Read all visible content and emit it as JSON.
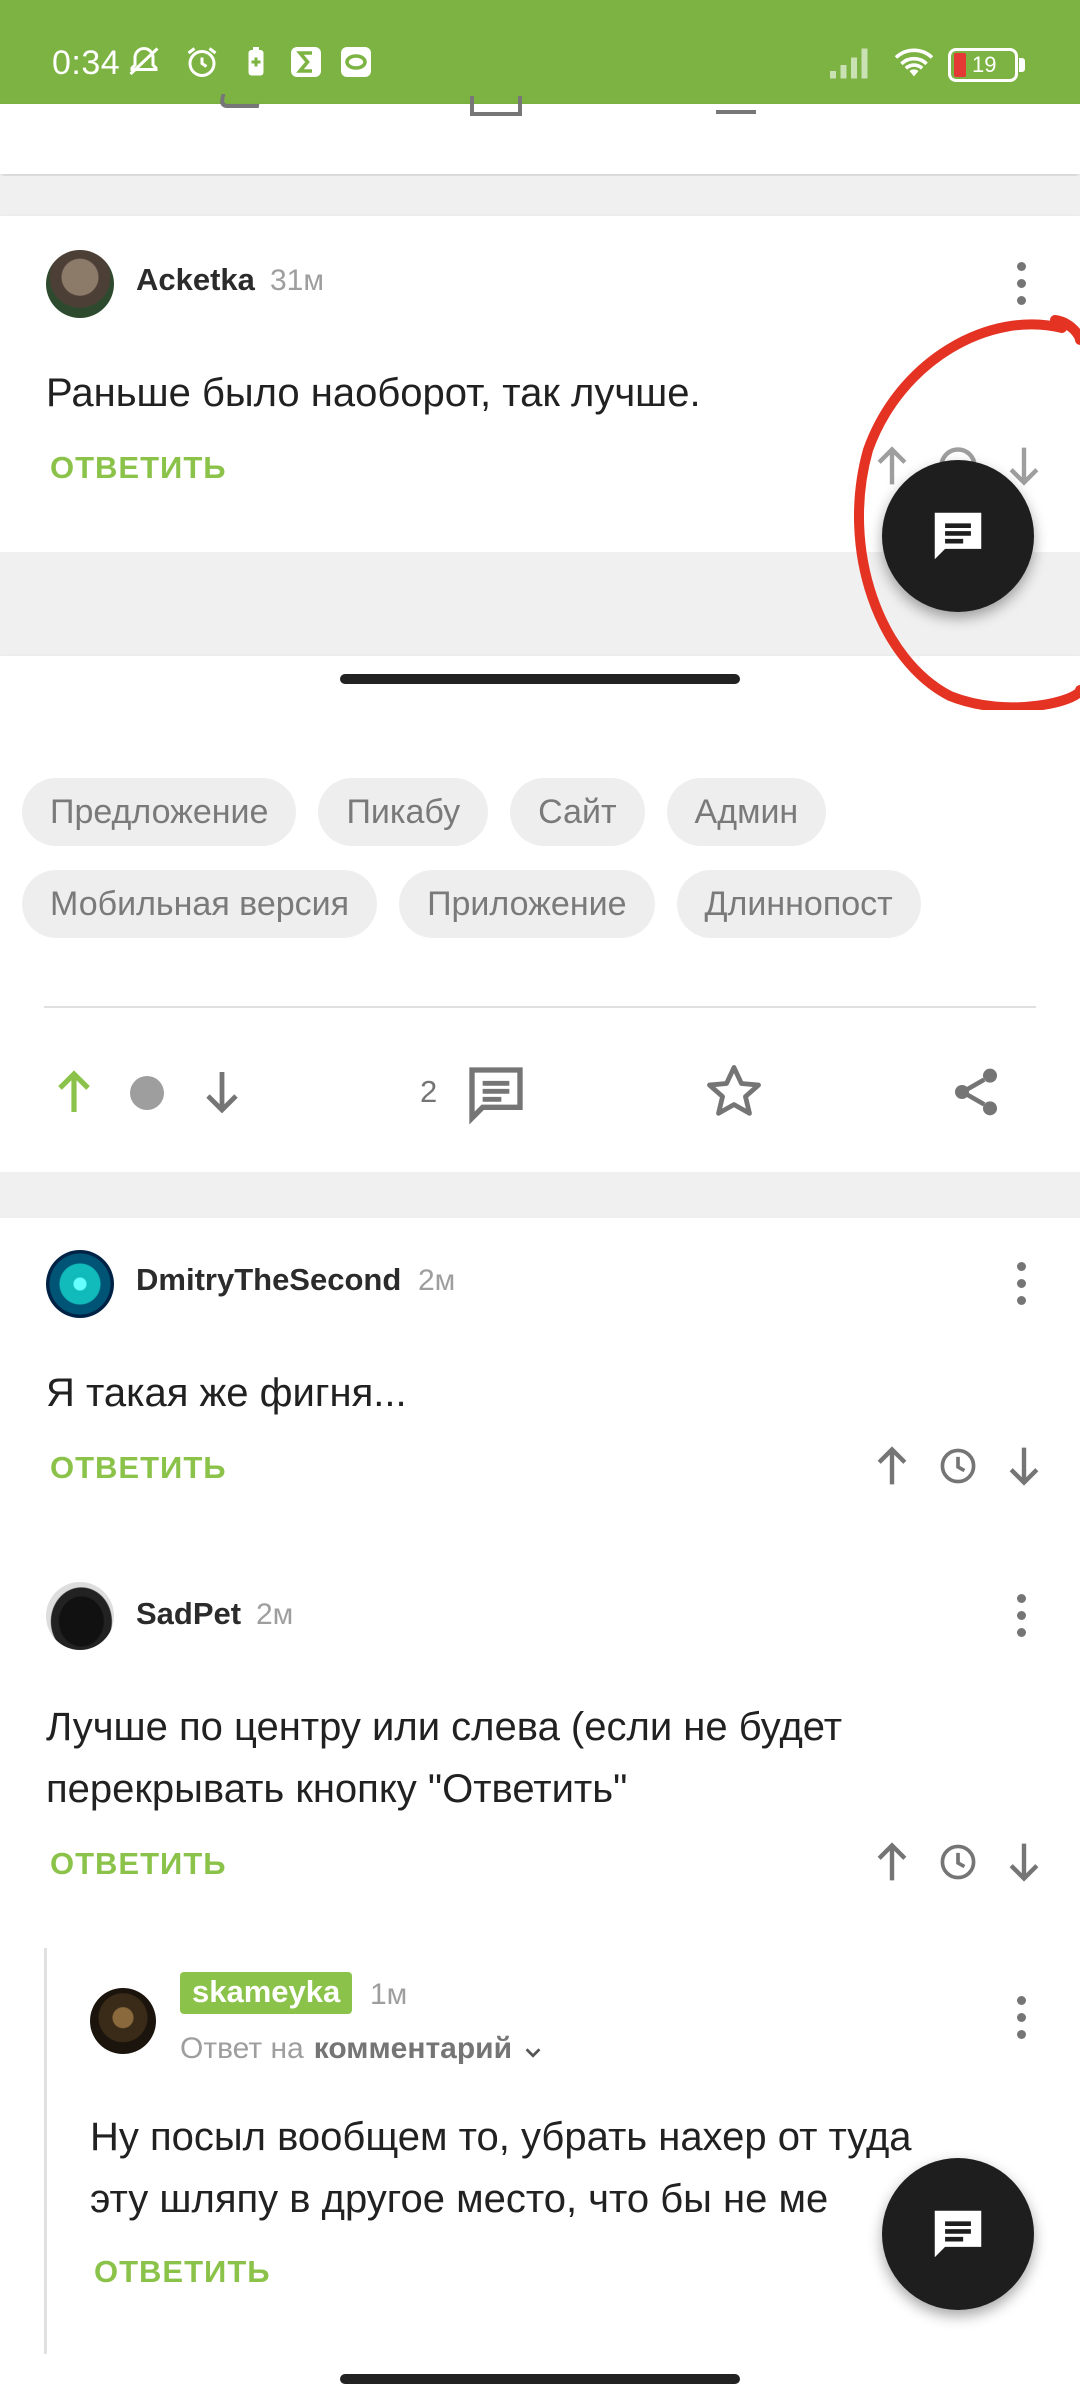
{
  "status_bar": {
    "time": "0:34",
    "battery": "19",
    "colors": {
      "bar": "#7cb342",
      "battery_low": "#e53935"
    }
  },
  "comments_top": {
    "user": "Acketka",
    "time": "31м",
    "text": "Раньше было наоборот, так лучше.",
    "reply_label": "ОТВЕТИТЬ"
  },
  "tags": [
    "Предложение",
    "Пикабу",
    "Сайт",
    "Админ",
    "Мобильная версия",
    "Приложение",
    "Длиннопост"
  ],
  "post_actions": {
    "comment_count": "2"
  },
  "comments": [
    {
      "user": "DmitryTheSecond",
      "time": "2м",
      "text": "Я такая же фигня...",
      "reply_label": "ОТВЕТИТЬ"
    },
    {
      "user": "SadPet",
      "time": "2м",
      "text_line1": "Лучше по центру или слева (если не будет",
      "text_line2": "перекрывать кнопку \"Ответить\"",
      "reply_label": "ОТВЕТИТЬ"
    },
    {
      "user": "skameyka",
      "time": "1м",
      "reply_to_prefix": "Ответ на",
      "reply_to_link": "комментарий",
      "text_line1": "Ну посыл вообщем то, убрать нахер от туда",
      "text_line2": "эту шляпу в другое место, что бы не ме",
      "reply_label": "ОТВЕТИТЬ"
    }
  ],
  "icons": {
    "fab": "comment-icon",
    "vote_up": "arrow-up-icon",
    "vote_down": "arrow-down-icon",
    "clock": "clock-icon",
    "star": "star-icon",
    "share": "share-icon"
  },
  "colors": {
    "accent_green": "#8bc34a",
    "annotation_red": "#e53323"
  }
}
